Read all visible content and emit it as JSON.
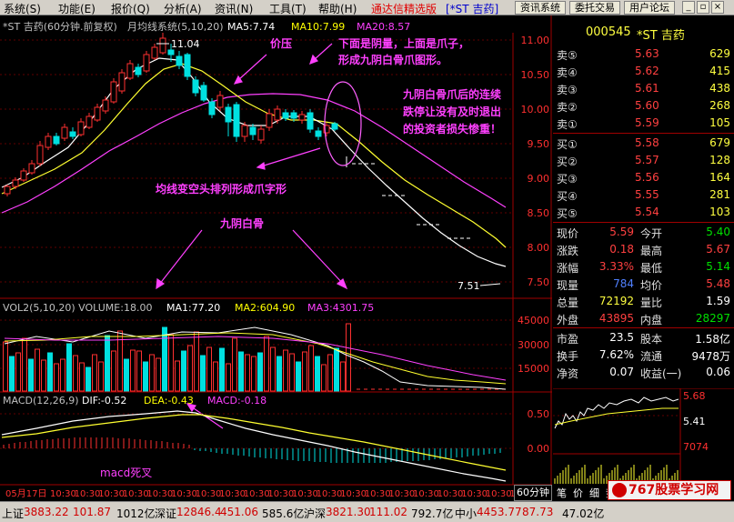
{
  "menu": [
    "系统(S)",
    "功能(E)",
    "报价(Q)",
    "分析(A)",
    "资讯(N)",
    "工具(T)",
    "帮助(H)"
  ],
  "promo": "通达信精选版",
  "window_title": "[*ST 吉药]",
  "toolbar_buttons": [
    "资讯系统",
    "委托交易",
    "用户论坛"
  ],
  "chart": {
    "header": {
      "name": "*ST 吉药(60分钟.前复权)",
      "indicator": "月均线系统(5,10,20)",
      "ma5": "MA5:7.74",
      "ma10": "MA10:7.99",
      "ma20": "MA20:8.57",
      "ma5_color": "#ffffff",
      "ma10_color": "#ffff00",
      "ma20_color": "#ff40ff"
    },
    "y_labels": [
      "11.00",
      "10.50",
      "10.00",
      "9.50",
      "9.00",
      "8.50",
      "8.00",
      "7.50"
    ],
    "high_label": "11.04",
    "low_label": "7.51",
    "annotations": {
      "price_pressure": "价压",
      "pattern_title_1": "下面是阴量，上面是爪子，",
      "pattern_title_2": "形成九阴白骨爪图形。",
      "loss_1": "九阴白骨爪后的连续",
      "loss_2": "跌停让没有及时退出",
      "loss_3": "的投资者损失惨重！",
      "ma_bear": "均线变空头排列形成爪字形",
      "nine_yin": "九阴白骨",
      "macd_death": "macd死叉"
    }
  },
  "volume": {
    "header": {
      "title": "VOL2(5,10,20) VOLUME:18.00",
      "ma1": "MA1:77.20",
      "ma2": "MA2:604.90",
      "ma3": "MA3:4301.75"
    },
    "y_labels": [
      "45000",
      "30000",
      "15000"
    ]
  },
  "macd": {
    "header": {
      "title": "MACD(12,26,9)",
      "dif": "DIF:-0.52",
      "dea": "DEA:-0.43",
      "macd": "MACD:-0.18"
    },
    "y_labels": [
      "0.50",
      "0.00"
    ]
  },
  "time_axis": [
    "05月17日",
    "10:30",
    "10:30",
    "10:30",
    "10:30",
    "10:30",
    "10:30",
    "10:30",
    "10:30",
    "10:30",
    "10:30",
    "10:30",
    "10:30",
    "10:30",
    "10:30",
    "10:30",
    "10:30",
    "10:30",
    "10:30",
    "10:30",
    "10:30"
  ],
  "period_label": "60分钟",
  "quote": {
    "code": "000545",
    "name": "*ST 吉药",
    "asks": [
      {
        "label": "卖⑤",
        "price": "5.63",
        "vol": "629"
      },
      {
        "label": "卖④",
        "price": "5.62",
        "vol": "415"
      },
      {
        "label": "卖③",
        "price": "5.61",
        "vol": "438"
      },
      {
        "label": "卖②",
        "price": "5.60",
        "vol": "268"
      },
      {
        "label": "卖①",
        "price": "5.59",
        "vol": "105"
      }
    ],
    "bids": [
      {
        "label": "买①",
        "price": "5.58",
        "vol": "679"
      },
      {
        "label": "买②",
        "price": "5.57",
        "vol": "128"
      },
      {
        "label": "买③",
        "price": "5.56",
        "vol": "164"
      },
      {
        "label": "买④",
        "price": "5.55",
        "vol": "281"
      },
      {
        "label": "买⑤",
        "price": "5.54",
        "vol": "103"
      }
    ],
    "stats": [
      {
        "l1": "现价",
        "v1": "5.59",
        "c1": "red",
        "l2": "今开",
        "v2": "5.40",
        "c2": "grn"
      },
      {
        "l1": "涨跌",
        "v1": "0.18",
        "c1": "red",
        "l2": "最高",
        "v2": "5.67",
        "c2": "red"
      },
      {
        "l1": "涨幅",
        "v1": "3.33%",
        "c1": "red",
        "l2": "最低",
        "v2": "5.14",
        "c2": "grn"
      },
      {
        "l1": "现量",
        "v1": "784",
        "c1": "blu",
        "l2": "均价",
        "v2": "5.48",
        "c2": "red"
      },
      {
        "l1": "总量",
        "v1": "72192",
        "c1": "yel",
        "l2": "量比",
        "v2": "1.59",
        "c2": "wht"
      },
      {
        "l1": "外盘",
        "v1": "43895",
        "c1": "red",
        "l2": "内盘",
        "v2": "28297",
        "c2": "grn"
      }
    ],
    "stats2": [
      {
        "l1": "市盈",
        "v1": "23.5",
        "l2": "股本",
        "v2": "1.58亿"
      },
      {
        "l1": "换手",
        "v1": "7.62%",
        "l2": "流通",
        "v2": "9478万"
      },
      {
        "l1": "净资",
        "v1": "0.07",
        "l2": "收益(一)",
        "v2": "0.06"
      }
    ],
    "mini": {
      "high": "5.68",
      "mid": "5.41",
      "vol": "7074"
    },
    "tabs": [
      "笔",
      "价",
      "细",
      "势",
      "联"
    ]
  },
  "status": {
    "sh_name": "上证",
    "sh_val": "3883.22",
    "sh_chg": "101.87",
    "sh_amt": "1012亿",
    "sz_name": "深证",
    "sz_val": "12846.4",
    "sz_chg": "451.06",
    "sz_amt": "585.6亿",
    "hs_name": "沪深",
    "hs_val": "3821.30",
    "hs_chg": "111.02",
    "hs_amt": "792.7亿",
    "zx_name": "中小",
    "zx_val": "4453.77",
    "zx_chg": "87.73",
    "zx_amt": "47.02亿"
  },
  "watermark": "767股票学习网"
}
